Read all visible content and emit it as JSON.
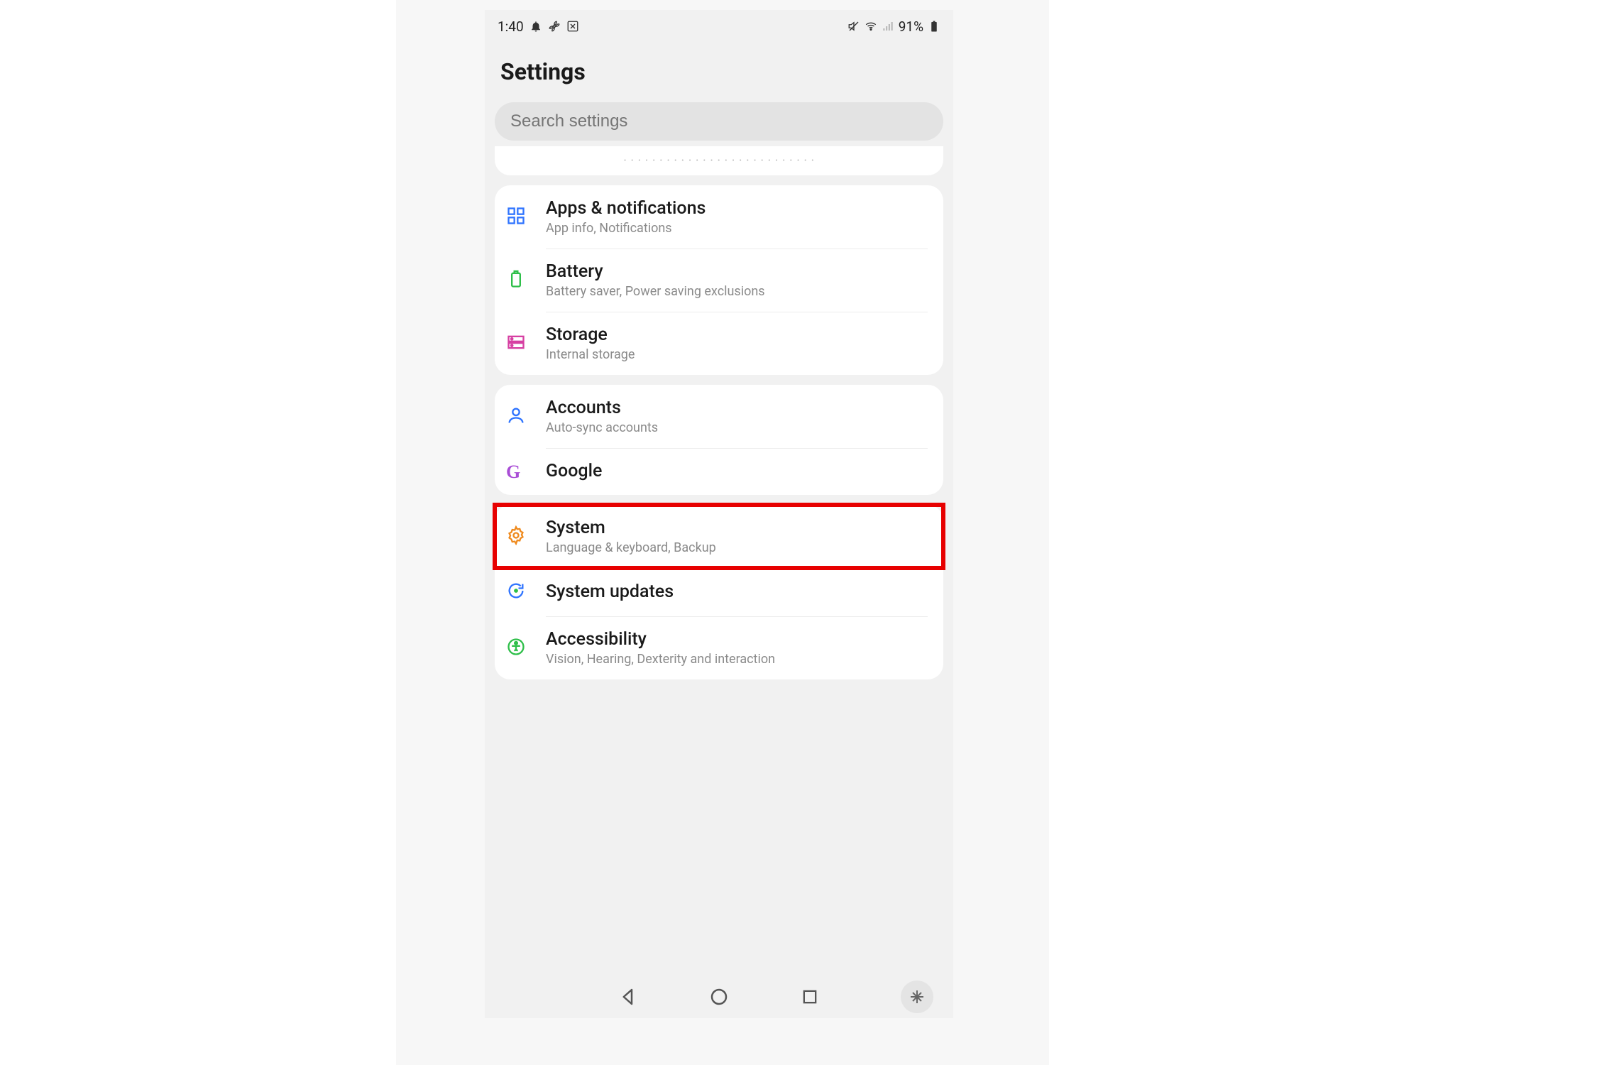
{
  "status": {
    "time": "1:40",
    "battery": "91%"
  },
  "header": {
    "title": "Settings"
  },
  "search": {
    "placeholder": "Search settings"
  },
  "groups": [
    {
      "rows": [
        {
          "title": "Apps & notifications",
          "sub": "App info, Notifications",
          "icon": "grid-icon",
          "color": "#2f74ff"
        },
        {
          "title": "Battery",
          "sub": "Battery saver, Power saving exclusions",
          "icon": "battery-icon",
          "color": "#2fbf4a"
        },
        {
          "title": "Storage",
          "sub": "Internal storage",
          "icon": "storage-icon",
          "color": "#d63fa2"
        }
      ]
    },
    {
      "rows": [
        {
          "title": "Accounts",
          "sub": "Auto-sync accounts",
          "icon": "accounts-icon",
          "color": "#2f74ff"
        },
        {
          "title": "Google",
          "sub": "",
          "icon": "google-icon",
          "color": "#a94dd6"
        }
      ]
    },
    {
      "rows": [
        {
          "title": "System",
          "sub": "Language & keyboard, Backup",
          "icon": "gear-icon",
          "color": "#ef8a1d",
          "highlight": true
        },
        {
          "title": "System updates",
          "sub": "",
          "icon": "update-icon",
          "color": "#2f74ff"
        },
        {
          "title": "Accessibility",
          "sub": "Vision, Hearing, Dexterity and interaction",
          "icon": "accessibility-icon",
          "color": "#2fbf4a"
        }
      ]
    }
  ]
}
